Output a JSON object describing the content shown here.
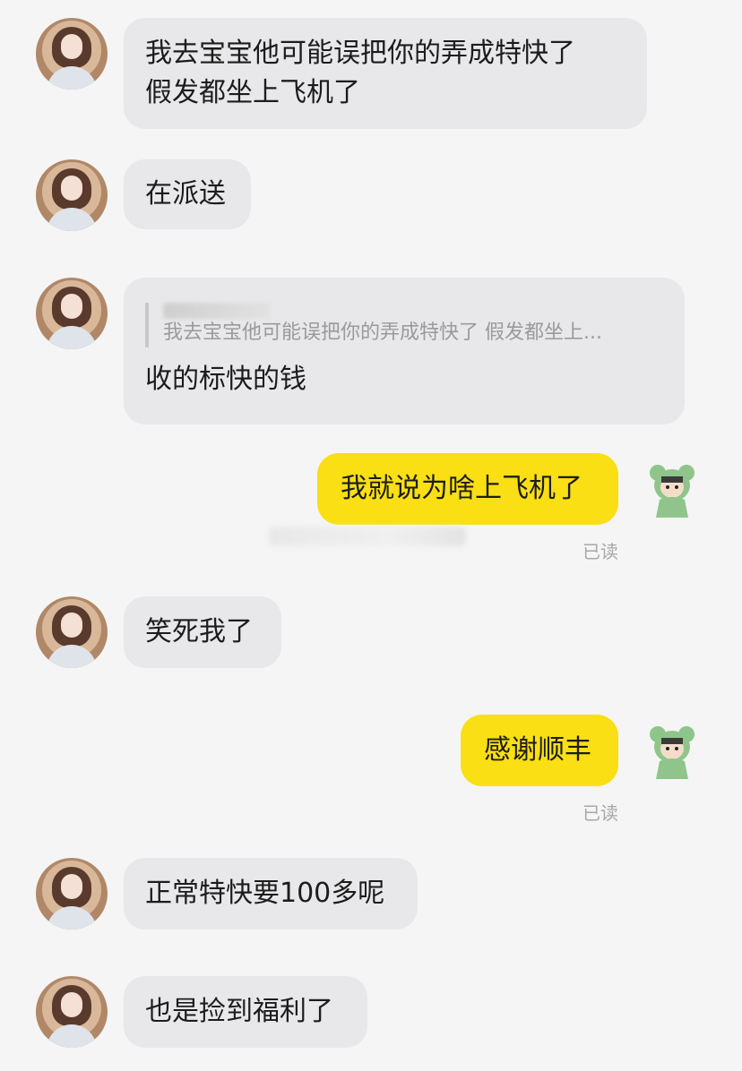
{
  "messages": [
    {
      "side": "in",
      "text_line1": "我去宝宝他可能误把你的弄成特快了",
      "text_line2": "假发都坐上飞机了"
    },
    {
      "side": "in",
      "text": "在派送"
    },
    {
      "side": "in",
      "quote": "我去宝宝他可能误把你的弄成特快了 假发都坐上...",
      "text": "收的标快的钱"
    },
    {
      "side": "out",
      "text": "我就说为啥上飞机了",
      "status": "已读"
    },
    {
      "side": "in",
      "text": "笑死我了"
    },
    {
      "side": "out",
      "text": "感谢顺丰",
      "status": "已读"
    },
    {
      "side": "in",
      "text": "正常特快要100多呢"
    },
    {
      "side": "in",
      "text": "也是捡到福利了"
    }
  ],
  "colors": {
    "incoming_bubble": "#e8e8ea",
    "outgoing_bubble": "#f9df13",
    "background": "#f5f5f5"
  },
  "icons": {
    "incoming_avatar": "girl-avatar",
    "outgoing_avatar": "frog-avatar"
  }
}
